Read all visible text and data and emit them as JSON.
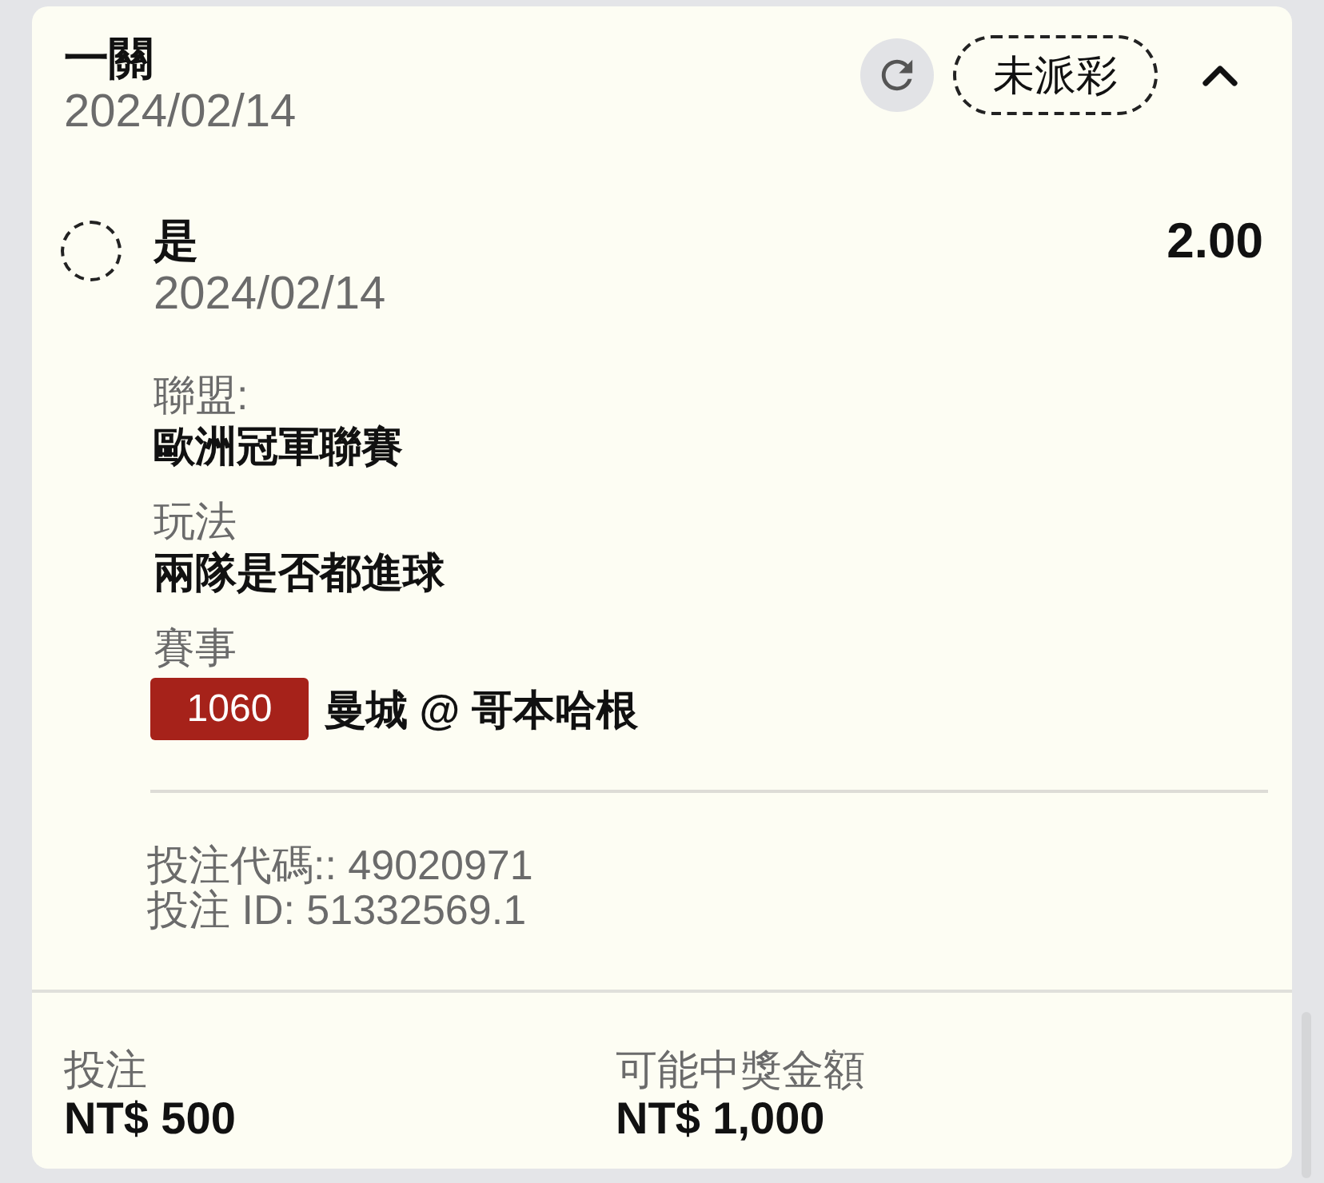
{
  "header": {
    "title": "一關",
    "date": "2024/02/14",
    "status": {
      "label": "未派彩",
      "pending": true
    },
    "expanded": true
  },
  "legs": [
    {
      "pick": "是",
      "date": "2024/02/14",
      "odds": "2.00",
      "pending": true,
      "details": [
        {
          "label": "聯盟:",
          "value": "歐洲冠軍聯賽"
        },
        {
          "label": "玩法",
          "value": "兩隊是否都進球"
        },
        {
          "label": "賽事",
          "code": "1060",
          "value": "曼城 @ 哥本哈根"
        }
      ],
      "references": [
        "投注代碼:: 49020971",
        "投注 ID: 51332569.1"
      ]
    }
  ],
  "summary": [
    {
      "label": "投注",
      "amount": "NT$ 500"
    },
    {
      "label": "可能中獎金額",
      "amount": "NT$ 1,000"
    }
  ]
}
